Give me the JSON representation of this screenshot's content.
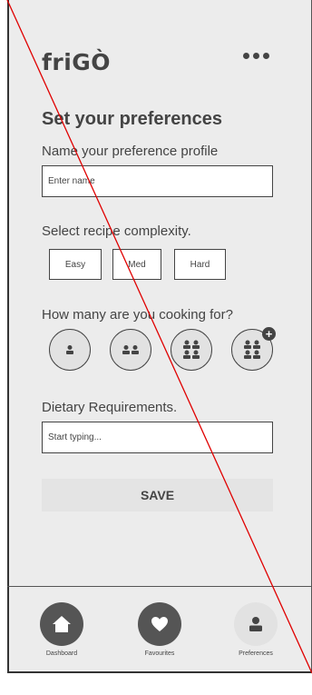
{
  "app": {
    "logo": "friGÒ"
  },
  "header": {
    "menu_icon": "more-dots-icon"
  },
  "title": "Set your preferences",
  "profile": {
    "label": "Name your preference profile",
    "placeholder": "Enter name"
  },
  "complexity": {
    "label": "Select recipe complexity.",
    "options": [
      "Easy",
      "Med",
      "Hard"
    ]
  },
  "servings": {
    "label": "How many are you cooking for?",
    "options": [
      "one-person-icon",
      "two-people-icon",
      "four-people-icon",
      "four-people-plus-icon"
    ]
  },
  "dietary": {
    "label": "Dietary Requirements.",
    "placeholder": "Start typing..."
  },
  "save_label": "SAVE",
  "tabs": [
    {
      "label": "Dashboard",
      "icon": "home-icon"
    },
    {
      "label": "Favourites",
      "icon": "heart-icon"
    },
    {
      "label": "Preferences",
      "icon": "person-icon",
      "active": true
    }
  ],
  "colors": {
    "primary": "#444444",
    "background": "#ececec",
    "inactive_circle": "#e2e2e2",
    "overlay_line": "#e00000"
  }
}
